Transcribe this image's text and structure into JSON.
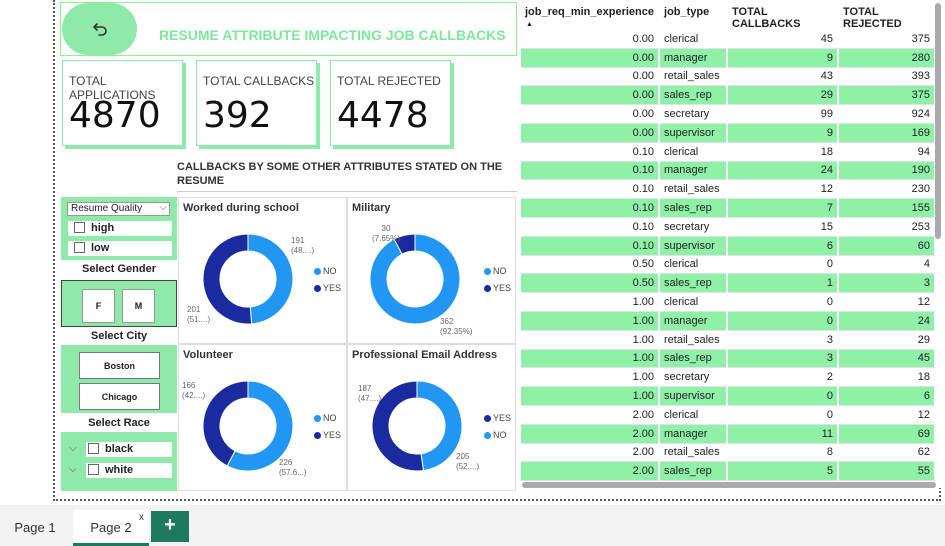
{
  "header": {
    "title": "RESUME ATTRIBUTE IMPACTING JOB  CALLBACKS",
    "back_icon": "undo-arrow-icon"
  },
  "kpis": [
    {
      "label": "TOTAL APPLICATIONS",
      "value": "4870"
    },
    {
      "label": "TOTAL CALLBACKS",
      "value": "392"
    },
    {
      "label": "TOTAL REJECTED",
      "value": "4478"
    }
  ],
  "section_title": "CALLBACKS BY SOME OTHER ATTRIBUTES STATED ON THE RESUME",
  "slicers": {
    "quality": {
      "label": "Resume Quality",
      "options": [
        "high",
        "low"
      ]
    },
    "gender": {
      "title": "Select Gender",
      "options": [
        "F",
        "M"
      ]
    },
    "city": {
      "title": "Select City",
      "options": [
        "Boston",
        "Chicago"
      ]
    },
    "race": {
      "title": "Select Race",
      "options": [
        "black",
        "white"
      ]
    }
  },
  "donuts": [
    {
      "title": "Worked during school",
      "no_label": "191\n(48....)",
      "yes_label": "201\n(51....)",
      "no": 191,
      "yes": 201,
      "legend": [
        "NO",
        "YES"
      ]
    },
    {
      "title": "Military",
      "no_label": "362\n(92.35%)",
      "yes_label": "30\n(7.65%)",
      "no": 362,
      "yes": 30,
      "legend": [
        "NO",
        "YES"
      ]
    },
    {
      "title": "Volunteer",
      "no_label": "226\n(57.6...)",
      "yes_label": "166\n(42....)",
      "no": 226,
      "yes": 166,
      "legend": [
        "NO",
        "YES"
      ]
    },
    {
      "title": "Professional Email Address",
      "no_label": "187\n(47....)",
      "yes_label": "205\n(52....)",
      "no": 187,
      "yes": 205,
      "legend": [
        "YES",
        "NO"
      ]
    }
  ],
  "colors": {
    "no": "#2196f3",
    "yes": "#1a2ba0",
    "accent": "#8fe9a8",
    "tab_active": "#1e7a5f"
  },
  "table": {
    "columns": [
      "job_req_min_experience",
      "job_type",
      "TOTAL CALLBACKS",
      "TOTAL REJECTED"
    ],
    "rows": [
      [
        "0.00",
        "clerical",
        "45",
        "375"
      ],
      [
        "0.00",
        "manager",
        "9",
        "280"
      ],
      [
        "0.00",
        "retail_sales",
        "43",
        "393"
      ],
      [
        "0.00",
        "sales_rep",
        "29",
        "375"
      ],
      [
        "0.00",
        "secretary",
        "99",
        "924"
      ],
      [
        "0.00",
        "supervisor",
        "9",
        "169"
      ],
      [
        "0.10",
        "clerical",
        "18",
        "94"
      ],
      [
        "0.10",
        "manager",
        "24",
        "190"
      ],
      [
        "0.10",
        "retail_sales",
        "12",
        "230"
      ],
      [
        "0.10",
        "sales_rep",
        "7",
        "155"
      ],
      [
        "0.10",
        "secretary",
        "15",
        "253"
      ],
      [
        "0.10",
        "supervisor",
        "6",
        "60"
      ],
      [
        "0.50",
        "clerical",
        "0",
        "4"
      ],
      [
        "0.50",
        "sales_rep",
        "1",
        "3"
      ],
      [
        "1.00",
        "clerical",
        "0",
        "12"
      ],
      [
        "1.00",
        "manager",
        "0",
        "24"
      ],
      [
        "1.00",
        "retail_sales",
        "3",
        "29"
      ],
      [
        "1.00",
        "sales_rep",
        "3",
        "45"
      ],
      [
        "1.00",
        "secretary",
        "2",
        "18"
      ],
      [
        "1.00",
        "supervisor",
        "0",
        "6"
      ],
      [
        "2.00",
        "clerical",
        "0",
        "12"
      ],
      [
        "2.00",
        "manager",
        "11",
        "69"
      ],
      [
        "2.00",
        "retail_sales",
        "8",
        "62"
      ],
      [
        "2.00",
        "sales_rep",
        "5",
        "55"
      ]
    ]
  },
  "pages": {
    "tabs": [
      "Page 1",
      "Page 2"
    ],
    "close": "x",
    "add": "+"
  }
}
